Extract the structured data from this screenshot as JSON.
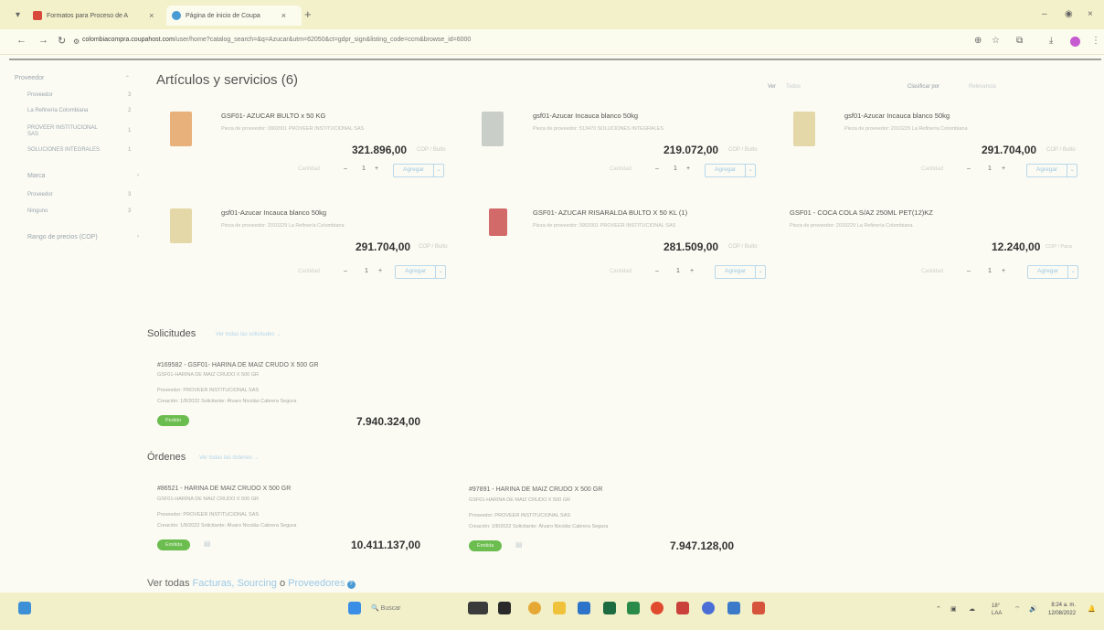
{
  "browser": {
    "tabs": [
      {
        "label": "Formatos para Proceso de A"
      },
      {
        "label": "Página de inicio de Coupa"
      }
    ],
    "url_host": "colombiacompra.coupahost.com",
    "url_rest": "/user/home?catalog_search=&q=Azucar&utm=62050&ct=gdpr_sign&listing_code=ccm&browse_id=6000"
  },
  "sidebar": {
    "sections": [
      {
        "title": "Proveedor",
        "items": [
          {
            "label": "Proveedor",
            "count": "3"
          },
          {
            "label": "La Refinería Colombiana",
            "count": "2"
          },
          {
            "label": "PROVEER INSTITUCIONAL SAS",
            "count": "1"
          },
          {
            "label": "SOLUCIONES INTEGRALES",
            "count": "1"
          }
        ]
      },
      {
        "title": "Marca",
        "items": [
          {
            "label": "Proveedor",
            "count": "3"
          },
          {
            "label": "Ninguno",
            "count": "3"
          }
        ]
      },
      {
        "title": "Rango de precios (COP)",
        "items": []
      }
    ]
  },
  "main": {
    "title": "Artículos y servicios (6)",
    "ver_label": "Ver",
    "ver_value": "Todos",
    "sort_label": "Clasificar por",
    "sort_value": "Relevancia",
    "products": [
      {
        "name": "GSF01- AZUCAR BULTO x 50 KG",
        "supplier": "Pieza de proveedor: 0902001 PROVEER INSTITUCIONAL SAS",
        "price": "321.896,00",
        "currency": "COP / Bulto",
        "qty": "1",
        "qty_label": "Cantidad",
        "add": "Agregar",
        "img_color": "#e8b07a"
      },
      {
        "name": "gsf01-Azucar Incauca blanco 50kg",
        "supplier": "Pieza de proveedor: 513470 SOLUCIONES INTEGRALES",
        "price": "219.072,00",
        "currency": "COP / Bulto",
        "qty": "1",
        "qty_label": "Cantidad",
        "add": "Agregar",
        "img_color": "#c9cfc8"
      },
      {
        "name": "gsf01-Azucar Incauca blanco 50kg",
        "supplier": "Pieza de proveedor: 2010229 La Refinería Colombiana",
        "price": "291.704,00",
        "currency": "COP / Bulto",
        "qty": "1",
        "qty_label": "Cantidad",
        "add": "Agregar",
        "img_color": "#e5d8a8"
      },
      {
        "name": "gsf01-Azucar Incauca blanco 50kg",
        "supplier": "Pieza de proveedor: 2010229 La Refinería Colombiana",
        "price": "291.704,00",
        "currency": "COP / Bulto",
        "qty": "1",
        "qty_label": "Cantidad",
        "add": "Agregar",
        "img_color": "#e5d8a8"
      },
      {
        "name": "GSF01- AZUCAR RISARALDA BULTO X 50 KL (1)",
        "supplier": "Pieza de proveedor: 0902001 PROVEER INSTITUCIONAL SAS",
        "price": "281.509,00",
        "currency": "COP / Bulto",
        "qty": "1",
        "qty_label": "Cantidad",
        "add": "Agregar",
        "img_color": "#d26a6a"
      },
      {
        "name": "GSF01 - COCA COLA S/AZ 250ML PET(12)KZ",
        "supplier": "Pieza de proveedor: 2010229 La Refinería Colombiana",
        "price": "12.240,00",
        "currency": "COP / Paca",
        "qty": "1",
        "qty_label": "Cantidad",
        "add": "Agregar",
        "img_color": ""
      }
    ]
  },
  "requests": {
    "title": "Solicitudes",
    "link": "Ver todas las solicitudes →",
    "items": [
      {
        "title": "#169582 - GSF01- HARINA DE MAIZ CRUDO X 500 GR",
        "sub": "GSF01-HARINA DE MAIZ CRUDO X 500 GR",
        "supplier": "Proveedor: PROVEER INSTITUCIONAL SAS",
        "meta": "Creación: 1/8/2022   Solicitante: Álvaro Nicolás Cabrera Segura",
        "status": "Pedido",
        "amount": "7.940.324,00"
      }
    ]
  },
  "orders": {
    "title": "Órdenes",
    "link": "Ver todas las órdenes →",
    "items": [
      {
        "title": "#86521 - HARINA DE MAIZ CRUDO X 500 GR",
        "sub": "GSF01-HARINA DE MAIZ CRUDO X 500 GR",
        "supplier": "Proveedor: PROVEER INSTITUCIONAL SAS",
        "meta": "Creación: 1/8/2022   Solicitante: Álvaro Nicolás Cabrera Segura",
        "status": "Emitida",
        "amount": "10.411.137,00"
      },
      {
        "title": "#97891 - HARINA DE MAIZ CRUDO X 500 GR",
        "sub": "GSF01-HARINA DE MAIZ CRUDO X 500 GR",
        "supplier": "Proveedor: PROVEER INSTITUCIONAL SAS",
        "meta": "Creación: 2/8/2022   Solicitante: Álvaro Nicolás Cabrera Segura",
        "status": "Emitida",
        "amount": "7.947.128,00"
      }
    ]
  },
  "footer": {
    "prefix": "Ver todas",
    "invoices": "Facturas,",
    "sourcing": "Sourcing",
    "or": "o",
    "suppliers": "Proveedores",
    "help": "?"
  },
  "taskbar": {
    "search": "Buscar",
    "weather": "18°",
    "weather_sub": "LAA",
    "time": "8:24 a. m.",
    "date": "12/08/2022"
  }
}
